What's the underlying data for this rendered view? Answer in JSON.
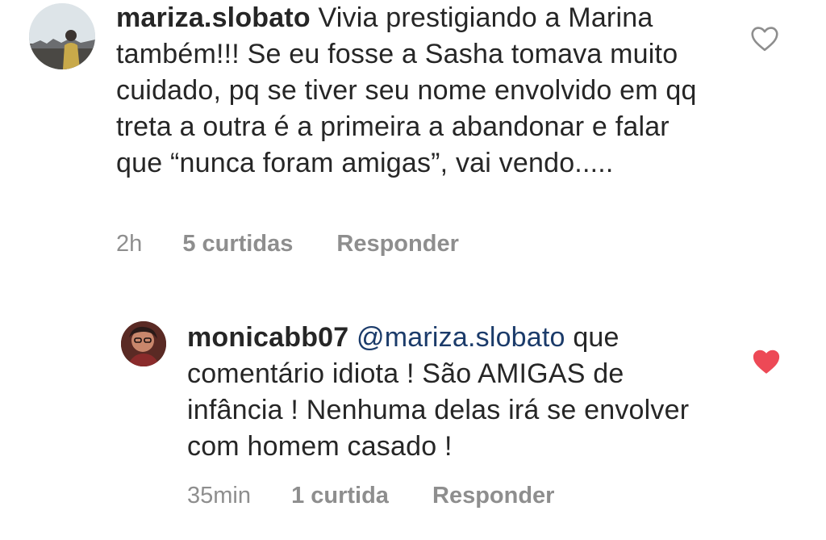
{
  "comments": {
    "main": {
      "username": "mariza.slobato",
      "text": "Vivia prestigiando a Marina também!!! Se eu fosse a Sasha tomava muito cuidado, pq se tiver seu nome envolvido em qq treta a outra é a primeira a abandonar e falar que “nunca foram amigas”, vai vendo.....",
      "time": "2h",
      "likes": "5 curtidas",
      "reply_label": "Responder",
      "heart_icon": "heart-outline-icon",
      "liked": false
    },
    "reply": {
      "username": "monicabb07",
      "mention": "@mariza.slobato",
      "text": "que comentário idiota ! São AMIGAS de infância !  Nenhuma delas irá se envolver com homem casado !",
      "time": "35min",
      "likes": "1 curtida",
      "reply_label": "Responder",
      "heart_icon": "heart-filled-icon",
      "liked": true
    }
  },
  "colors": {
    "text": "#262626",
    "meta": "#8e8e8e",
    "mention": "#1b3b6a",
    "liked_heart": "#ed4956",
    "outline_heart": "#8e8e8e"
  }
}
